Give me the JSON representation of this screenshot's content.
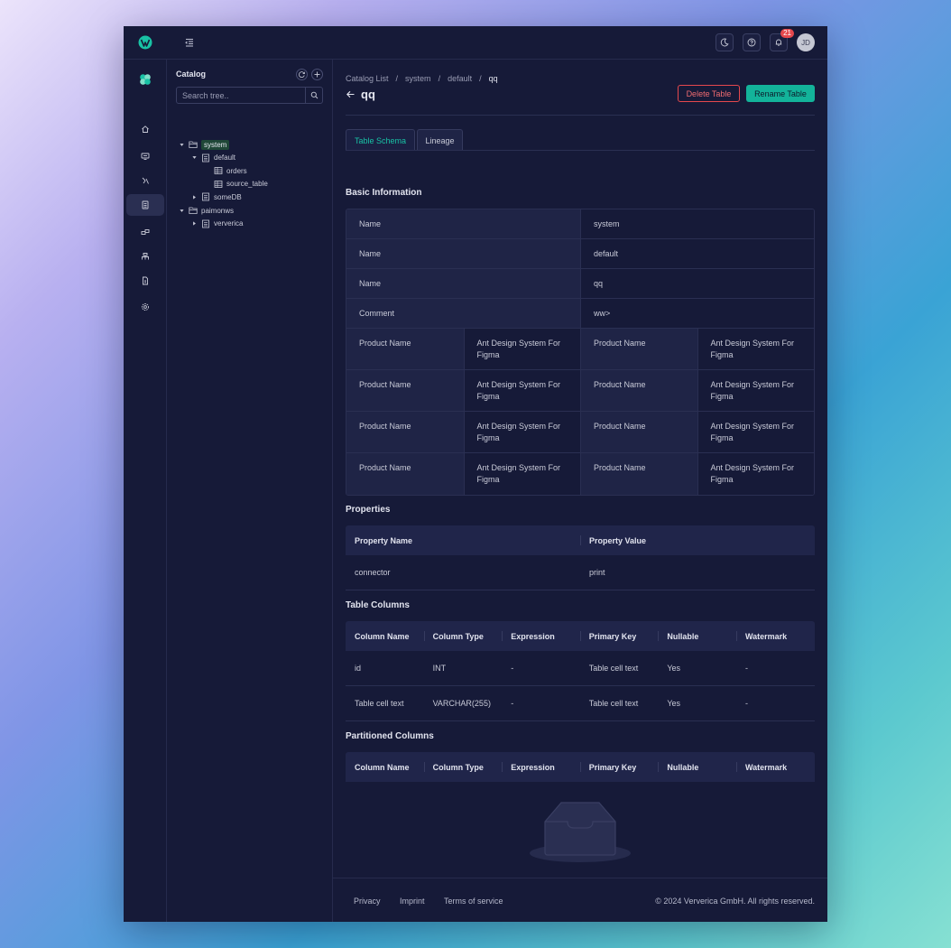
{
  "header": {
    "notification_count": "21",
    "avatar_initials": "JD"
  },
  "catalog": {
    "title": "Catalog",
    "search_placeholder": "Search tree..",
    "tree": [
      {
        "label": "system",
        "level": 0,
        "type": "folder",
        "expanded": true,
        "selected": true
      },
      {
        "label": "default",
        "level": 1,
        "type": "database",
        "expanded": true
      },
      {
        "label": "orders",
        "level": 2,
        "type": "table"
      },
      {
        "label": "source_table",
        "level": 2,
        "type": "table"
      },
      {
        "label": "someDB",
        "level": 1,
        "type": "database",
        "expanded": false
      },
      {
        "label": "paimonws",
        "level": 0,
        "type": "folder",
        "expanded": true
      },
      {
        "label": "ververica",
        "level": 1,
        "type": "database",
        "expanded": false
      }
    ]
  },
  "breadcrumb": [
    "Catalog List",
    "system",
    "default",
    "qq"
  ],
  "page": {
    "title": "qq",
    "delete_label": "Delete Table",
    "rename_label": "Rename Table"
  },
  "tabs": [
    {
      "label": "Table Schema",
      "active": true
    },
    {
      "label": "Lineage",
      "active": false
    }
  ],
  "basic_info": {
    "title": "Basic Information",
    "rows": [
      {
        "label": "Name",
        "value": "system"
      },
      {
        "label": "Name",
        "value": "default"
      },
      {
        "label": "Name",
        "value": "qq"
      },
      {
        "label": "Comment",
        "value": "ww>"
      }
    ],
    "pair_rows": [
      [
        "Product Name",
        "Ant Design System For Figma",
        "Product Name",
        "Ant Design System For Figma"
      ],
      [
        "Product Name",
        "Ant Design System For Figma",
        "Product Name",
        "Ant Design System For Figma"
      ],
      [
        "Product Name",
        "Ant Design System For Figma",
        "Product Name",
        "Ant Design System For Figma"
      ],
      [
        "Product Name",
        "Ant Design System For Figma",
        "Product Name",
        "Ant Design System For Figma"
      ]
    ]
  },
  "properties": {
    "title": "Properties",
    "headers": [
      "Property Name",
      "Property Value"
    ],
    "rows": [
      [
        "connector",
        "print"
      ]
    ]
  },
  "table_columns": {
    "title": "Table Columns",
    "headers": [
      "Column Name",
      "Column Type",
      "Expression",
      "Primary Key",
      "Nullable",
      "Watermark"
    ],
    "rows": [
      [
        "id",
        "INT",
        "-",
        "Table cell text",
        "Yes",
        "-"
      ],
      [
        "Table cell text",
        "VARCHAR(255)",
        "-",
        "Table cell text",
        "Yes",
        "-"
      ]
    ]
  },
  "partitioned_columns": {
    "title": "Partitioned Columns",
    "headers": [
      "Column Name",
      "Column Type",
      "Expression",
      "Primary Key",
      "Nullable",
      "Watermark"
    ],
    "rows": []
  },
  "footer": {
    "links": [
      "Privacy",
      "Imprint",
      "Terms of service"
    ],
    "copyright": "© 2024 Ververica GmbH. All rights reserved."
  },
  "colors": {
    "accent": "#13b39a",
    "danger": "#e5484d",
    "background": "#161a38"
  }
}
